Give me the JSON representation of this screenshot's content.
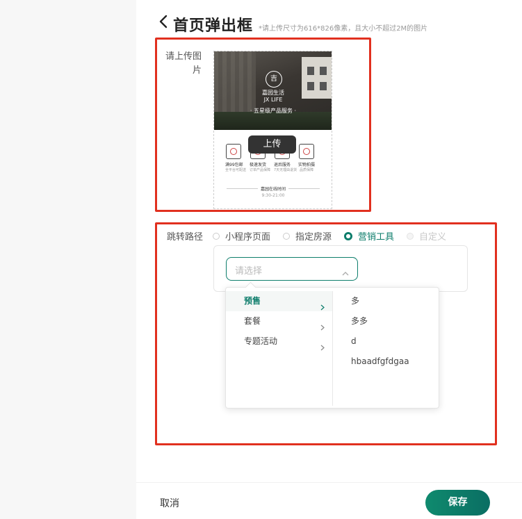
{
  "header": {
    "title": "首页弹出框",
    "hint": "*请上传尺寸为616*826像素，且大小不超过2M的图片"
  },
  "upload": {
    "label": "请上传图片",
    "tooltip": "上传",
    "poster": {
      "logo": "吉",
      "brand_cn": "嘉园生活",
      "brand_en": "JX LIFE",
      "slogan": "· 五星级产品服务 ·",
      "icons": [
        {
          "name": "truck-icon",
          "title": "满99包邮",
          "sub": "全平台可配送"
        },
        {
          "name": "gift-icon",
          "title": "极速发货",
          "sub": "订单产品保障"
        },
        {
          "name": "return-icon",
          "title": "退后服务",
          "sub": "7天无理由退货"
        },
        {
          "name": "check-icon",
          "title": "实物拍摄",
          "sub": "品质保障"
        }
      ],
      "footer_title": "嘉园在线时间",
      "footer_time": "9:30-21:00"
    }
  },
  "route": {
    "label": "跳转路径",
    "options": [
      {
        "label": "小程序页面",
        "state": "unchecked"
      },
      {
        "label": "指定房源",
        "state": "unchecked"
      },
      {
        "label": "营销工具",
        "state": "checked"
      },
      {
        "label": "自定义",
        "state": "disabled"
      }
    ],
    "select_placeholder": "请选择"
  },
  "cascader": {
    "level1": [
      "预售",
      "套餐",
      "专题活动"
    ],
    "active_index": 0,
    "level2": [
      "多",
      "多多",
      "d",
      "hbaadfgfdgaa"
    ]
  },
  "footer": {
    "cancel": "取消",
    "save": "保存"
  },
  "colors": {
    "accent": "#0d7d6b",
    "highlight_border": "#e1301f"
  }
}
